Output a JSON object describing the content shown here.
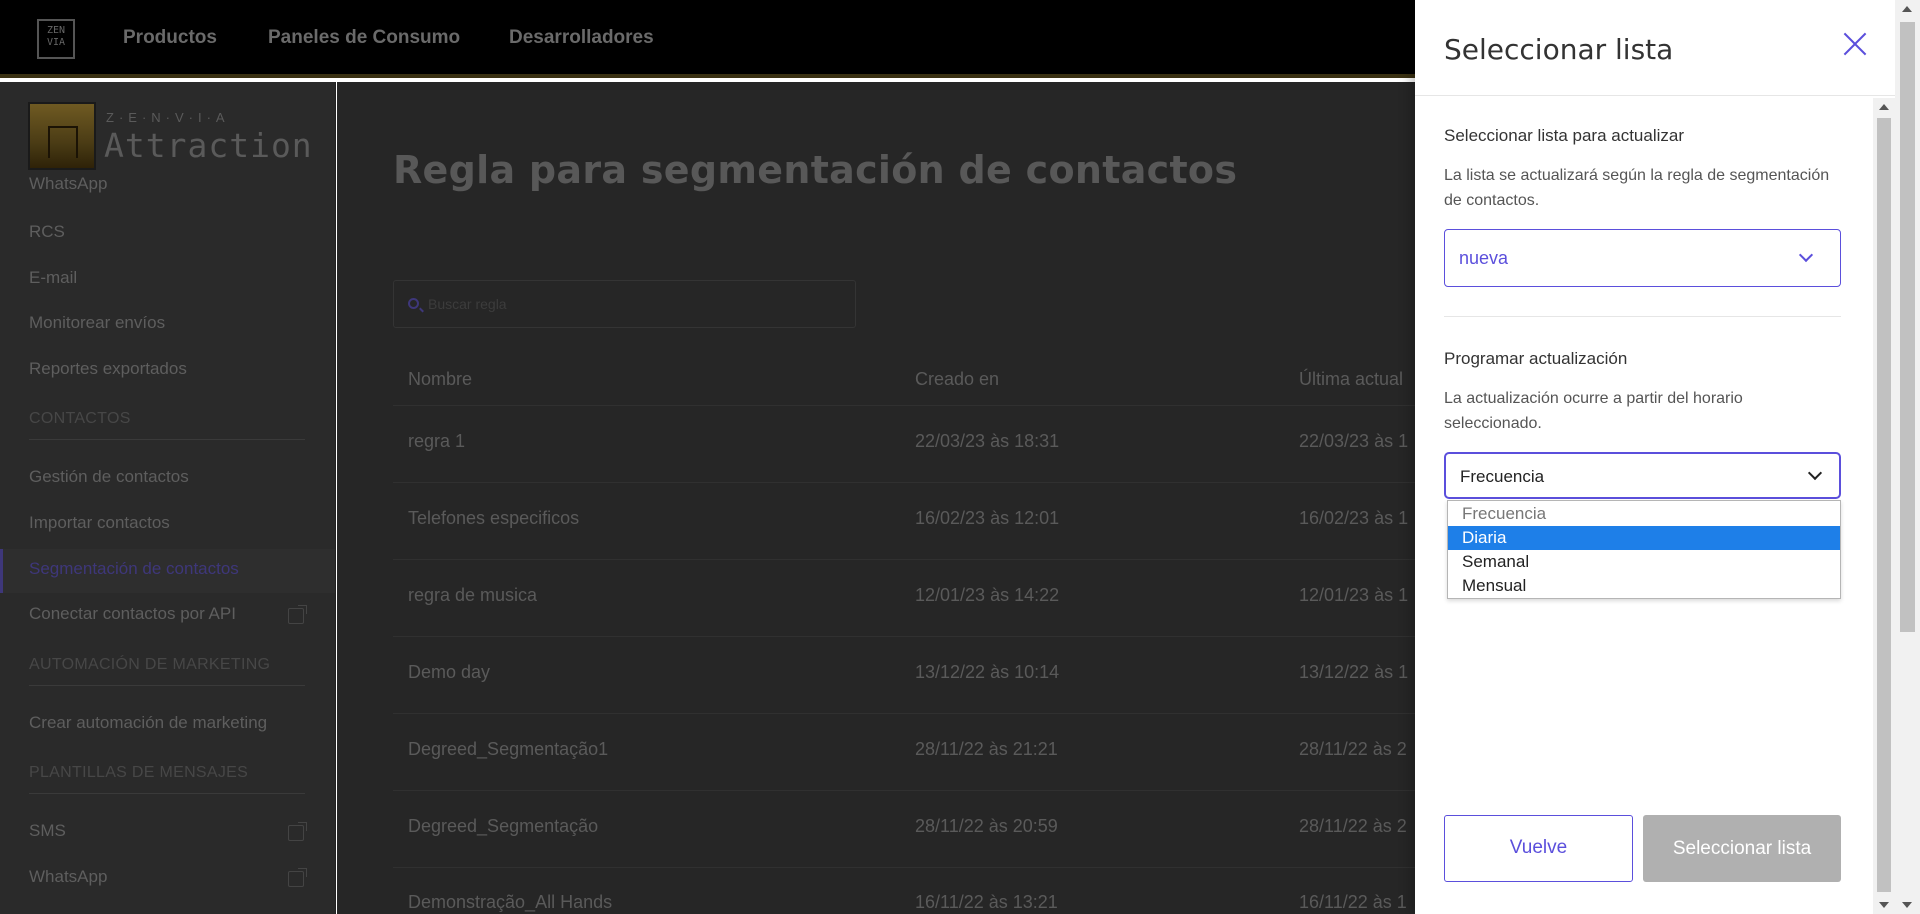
{
  "topnav": {
    "logo_text": "ZEN VIA",
    "items": [
      "Productos",
      "Paneles de Consumo",
      "Desarrolladores"
    ]
  },
  "sidebar": {
    "brand_top": "Z·E·N·V·I·A",
    "brand_main": "Attraction",
    "partial_item": "WhatsApp",
    "items_channels": [
      "RCS",
      "E-mail",
      "Monitorear envíos",
      "Reportes exportados"
    ],
    "head_contacts": "CONTACTOS",
    "items_contacts": [
      "Gestión de contactos",
      "Importar contactos",
      "Segmentación de contactos",
      "Conectar contactos por API"
    ],
    "head_automation": "AUTOMACIÓN DE MARKETING",
    "items_automation": [
      "Crear automación de marketing"
    ],
    "head_templates": "PLANTILLAS DE MENSAJES",
    "items_templates": [
      "SMS",
      "WhatsApp"
    ]
  },
  "main": {
    "title": "Regla para segmentación de contactos",
    "search_placeholder": "Buscar regla",
    "columns": [
      "Nombre",
      "Creado en",
      "Última actual"
    ],
    "rows": [
      {
        "name": "regra 1",
        "created": "22/03/23 às 18:31",
        "updated": "22/03/23 às 1"
      },
      {
        "name": "Telefones especificos",
        "created": "16/02/23 às 12:01",
        "updated": "16/02/23 às 1"
      },
      {
        "name": "regra de musica",
        "created": "12/01/23 às 14:22",
        "updated": "12/01/23 às 1"
      },
      {
        "name": "Demo day",
        "created": "13/12/22 às 10:14",
        "updated": "13/12/22 às 1"
      },
      {
        "name": "Degreed_Segmentação1",
        "created": "28/11/22 às 21:21",
        "updated": "28/11/22 às 2"
      },
      {
        "name": "Degreed_Segmentação",
        "created": "28/11/22 às 20:59",
        "updated": "28/11/22 às 2"
      },
      {
        "name": "Demonstração_All Hands",
        "created": "16/11/22 às 13:21",
        "updated": "16/11/22 às 1"
      }
    ]
  },
  "panel": {
    "title": "Seleccionar lista",
    "section1_title": "Seleccionar lista para actualizar",
    "section1_desc": "La lista se actualizará según la regla de segmentación de contactos.",
    "list_value": "nueva",
    "section2_title": "Programar actualización",
    "section2_desc": "La actualización ocurre a partir del horario seleccionado.",
    "frequency_value": "Frecuencia",
    "frequency_options": [
      "Frecuencia",
      "Diaria",
      "Semanal",
      "Mensual"
    ],
    "back_label": "Vuelve",
    "select_label": "Seleccionar lista"
  },
  "colors": {
    "accent": "#5b4fdc",
    "highlight": "#1e7fe8",
    "disabled": "#b0b0b0"
  }
}
